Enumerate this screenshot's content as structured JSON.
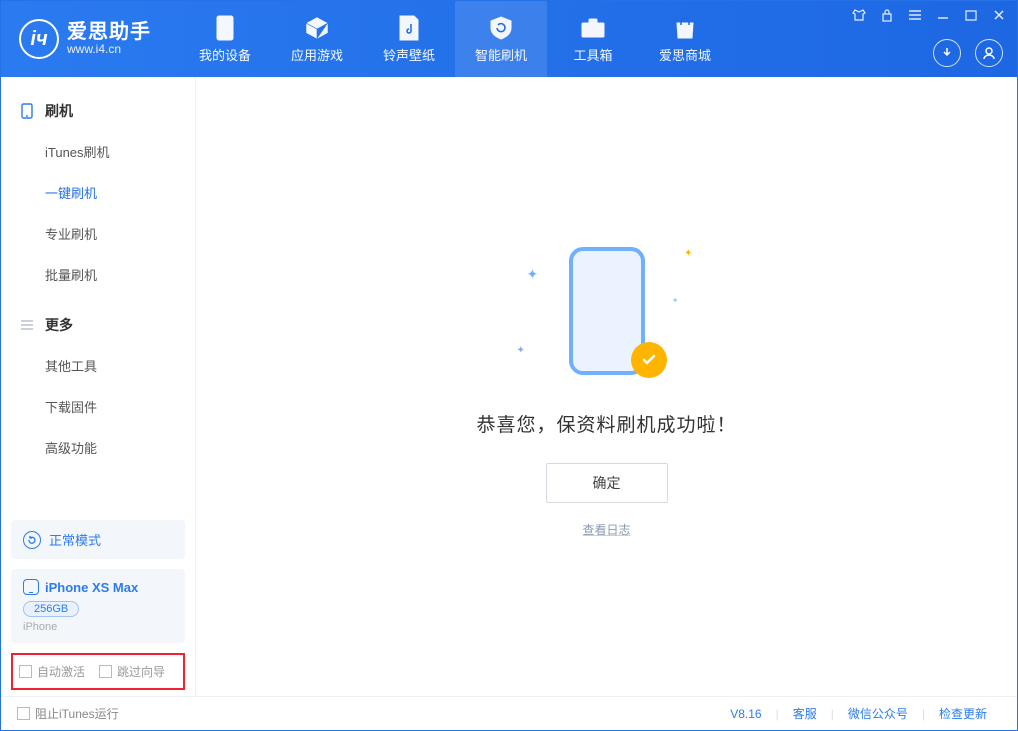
{
  "app": {
    "title": "爱思助手",
    "subtitle": "www.i4.cn"
  },
  "tabs": [
    {
      "label": "我的设备"
    },
    {
      "label": "应用游戏"
    },
    {
      "label": "铃声壁纸"
    },
    {
      "label": "智能刷机"
    },
    {
      "label": "工具箱"
    },
    {
      "label": "爱思商城"
    }
  ],
  "sidebar": {
    "group1_label": "刷机",
    "items1": [
      {
        "label": "iTunes刷机"
      },
      {
        "label": "一键刷机"
      },
      {
        "label": "专业刷机"
      },
      {
        "label": "批量刷机"
      }
    ],
    "group2_label": "更多",
    "items2": [
      {
        "label": "其他工具"
      },
      {
        "label": "下载固件"
      },
      {
        "label": "高级功能"
      }
    ]
  },
  "mode": {
    "label": "正常模式"
  },
  "device": {
    "name": "iPhone XS Max",
    "storage": "256GB",
    "type": "iPhone"
  },
  "options": {
    "auto_activate": "自动激活",
    "skip_guide": "跳过向导"
  },
  "main": {
    "success_msg": "恭喜您，保资料刷机成功啦！",
    "ok_label": "确定",
    "log_link": "查看日志"
  },
  "status": {
    "block_itunes": "阻止iTunes运行",
    "version": "V8.16",
    "support": "客服",
    "wechat": "微信公众号",
    "update": "检查更新"
  }
}
